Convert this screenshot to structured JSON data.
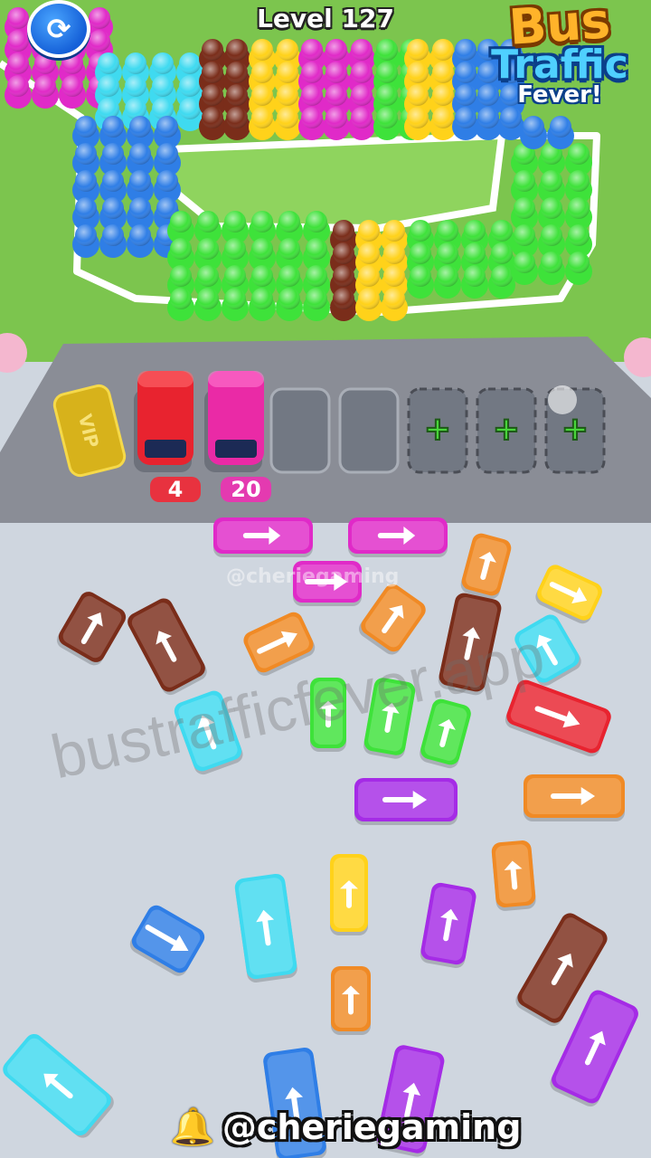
{
  "hud": {
    "level": "Level 127",
    "restart_icon": "restart-icon",
    "logo_line1": "Bus",
    "logo_line2": "Traffic",
    "logo_line3": "Fever!"
  },
  "dock": {
    "vip_label": "VIP",
    "slot1_count": "4",
    "slot2_count": "20",
    "locked_slot_icon": "plus-icon",
    "colors": {
      "red": "#e8232f",
      "pink": "#ea2aa6"
    }
  },
  "overlay": {
    "watermark": "bustrafficfever.app",
    "faint_handle": "@cheriegaming",
    "handle": "@cheriegaming",
    "handle_icon": "bell-icon"
  },
  "palette": {
    "grass": "#7cc54e",
    "asphalt": "#8a8d96",
    "lot": "#cfd6df",
    "red": "#e8232f",
    "pink": "#ea2aa6",
    "orange": "#f08a25",
    "brown": "#7a2d1a",
    "yellow": "#ffd21a",
    "cyan": "#3fdaf0",
    "green": "#3ee23a",
    "purple": "#a52be6",
    "blue": "#2f7ee6",
    "magenta": "#e02ac8"
  }
}
